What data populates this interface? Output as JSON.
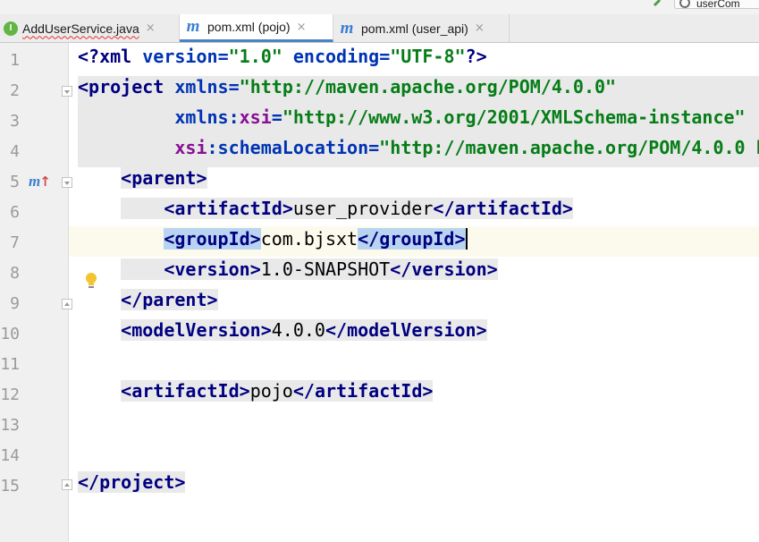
{
  "toolbar": {
    "run_config_label": "userCom"
  },
  "tabs": [
    {
      "label": "AddUserService.java",
      "icon": "interface-icon",
      "icon_letter": "I",
      "active": false,
      "has_error": true
    },
    {
      "label": "pom.xml (pojo)",
      "icon": "maven-icon",
      "icon_letter": "m",
      "active": true,
      "has_error": false
    },
    {
      "label": "pom.xml (user_api)",
      "icon": "maven-icon",
      "icon_letter": "m",
      "active": false,
      "has_error": false
    }
  ],
  "tab_close_glyph": "×",
  "gutter": {
    "line_numbers": [
      "1",
      "2",
      "3",
      "4",
      "5",
      "6",
      "7",
      "8",
      "9",
      "10",
      "11",
      "12",
      "13",
      "14",
      "15"
    ],
    "override_marker": "m",
    "override_arrow": "↑"
  },
  "code": {
    "l1": {
      "open": "<?",
      "name": "xml",
      "a1": "version",
      "eq1": "=",
      "v1": "\"1.0\"",
      "a2": "encoding",
      "eq2": "=",
      "v2": "\"UTF-8\"",
      "close": "?>"
    },
    "l2": {
      "open": "<",
      "name": "project",
      "a1": "xmlns",
      "eq1": "=",
      "v1": "\"http://maven.apache.org/POM/4.0.0\""
    },
    "l3": {
      "prefix": "xmlns",
      "colon": ":",
      "name": "xsi",
      "eq": "=",
      "value": "\"http://www.w3.org/2001/XMLSchema-instance\""
    },
    "l4": {
      "prefix": "xsi",
      "colon": ":",
      "name": "schemaLocation",
      "eq": "=",
      "value": "\"http://maven.apache.org/POM/4.0.0 h"
    },
    "l5": {
      "open": "<",
      "name": "parent",
      "close": ">"
    },
    "l6": {
      "open": "<",
      "name": "artifactId",
      "close": ">",
      "text": "user_provider",
      "end_open": "</",
      "end_name": "artifactId",
      "end_close": ">"
    },
    "l7": {
      "open": "<",
      "name": "groupId",
      "close": ">",
      "text": "com.bjsxt",
      "end_open": "</",
      "end_name": "groupId",
      "end_close": ">"
    },
    "l8": {
      "open": "<",
      "name": "version",
      "close": ">",
      "text": "1.0-SNAPSHOT",
      "end_open": "</",
      "end_name": "version",
      "end_close": ">"
    },
    "l9": {
      "open": "</",
      "name": "parent",
      "close": ">"
    },
    "l10": {
      "open": "<",
      "name": "modelVersion",
      "close": ">",
      "text": "4.0.0",
      "end_open": "</",
      "end_name": "modelVersion",
      "end_close": ">"
    },
    "l12": {
      "open": "<",
      "name": "artifactId",
      "close": ">",
      "text": "pojo",
      "end_open": "</",
      "end_name": "artifactId",
      "end_close": ">"
    },
    "l15": {
      "open": "</",
      "name": "project",
      "close": ">"
    }
  }
}
